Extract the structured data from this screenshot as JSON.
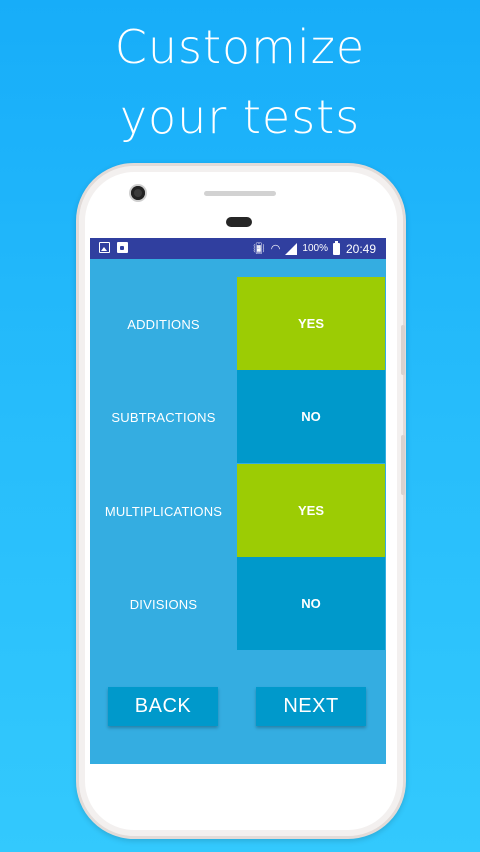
{
  "headline": {
    "line1": "Customize",
    "line2": "your tests"
  },
  "status_bar": {
    "battery_percent": "100%",
    "time": "20:49",
    "icons": [
      "image-icon",
      "bag-icon",
      "vibrate-icon",
      "wifi-icon",
      "signal-icon",
      "battery-icon"
    ]
  },
  "settings": [
    {
      "label": "ADDITIONS",
      "value": "YES"
    },
    {
      "label": "SUBTRACTIONS",
      "value": "NO"
    },
    {
      "label": "MULTIPLICATIONS",
      "value": "YES"
    },
    {
      "label": "DIVISIONS",
      "value": "NO"
    }
  ],
  "buttons": {
    "back": "BACK",
    "next": "NEXT"
  },
  "colors": {
    "background_top": "#17adf9",
    "background_bottom": "#33c9fd",
    "screen_bg": "#34ade1",
    "yes_color": "#9ccc04",
    "no_color": "#0099cb",
    "status_bar": "#303f9f"
  }
}
